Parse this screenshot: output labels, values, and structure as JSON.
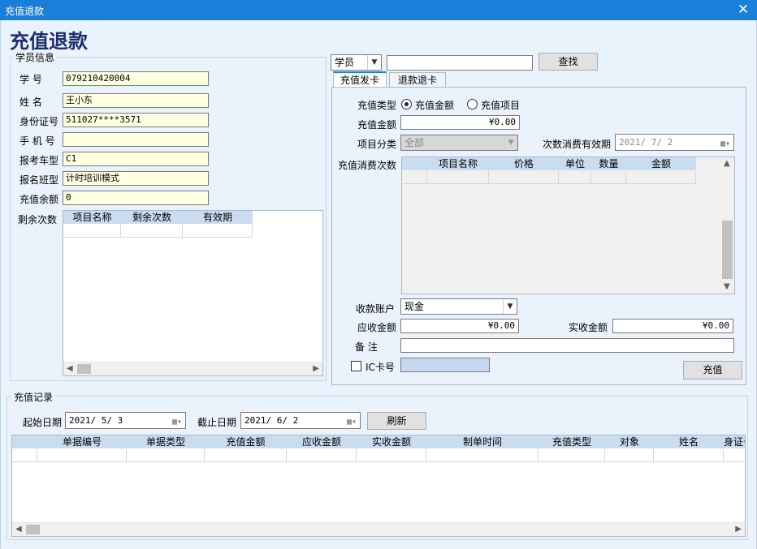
{
  "window": {
    "title": "充值退款",
    "close_glyph": "✕"
  },
  "page_title": "充值退款",
  "student_info": {
    "legend": "学员信息",
    "fields": [
      {
        "label": "学    号",
        "value": "079210420004"
      },
      {
        "label": "姓    名",
        "value": "王小东"
      },
      {
        "label": "身份证号",
        "value": "511027****3571"
      },
      {
        "label": "手 机 号",
        "value": ""
      },
      {
        "label": "报考车型",
        "value": "C1"
      },
      {
        "label": "报名班型",
        "value": "计时培训模式"
      },
      {
        "label": "充值余额",
        "value": "0"
      }
    ],
    "remaining_label": "剩余次数",
    "remaining_columns": [
      "项目名称",
      "剩余次数",
      "有效期"
    ]
  },
  "search": {
    "type_selected": "学员",
    "value": "",
    "button": "查找"
  },
  "tabs": [
    {
      "label": "充值发卡",
      "active": true
    },
    {
      "label": "退款退卡",
      "active": false
    }
  ],
  "recharge": {
    "type_label": "充值类型",
    "type_options": [
      {
        "label": "充值金额",
        "checked": true
      },
      {
        "label": "充值项目",
        "checked": false
      }
    ],
    "amount_label": "充值金额",
    "amount_value": "¥0.00",
    "category_label": "项目分类",
    "category_value": "全部",
    "validity_label": "次数消费有效期",
    "validity_value": "2021/ 7/ 2",
    "count_label": "充值消费次数",
    "count_columns": [
      "项目名称",
      "价格",
      "单位",
      "数量",
      "金额"
    ],
    "account_label": "收款账户",
    "account_value": "现金",
    "receivable_label": "应收金额",
    "receivable_value": "¥0.00",
    "received_label": "实收金额",
    "received_value": "¥0.00",
    "remark_label": "备    注",
    "remark_value": "",
    "ic_label": "IC卡号",
    "ic_checked": false,
    "ic_value": "",
    "submit": "充值"
  },
  "records": {
    "legend": "充值记录",
    "start_label": "起始日期",
    "start_value": "2021/ 5/ 3",
    "end_label": "截止日期",
    "end_value": "2021/ 6/ 2",
    "refresh": "刷新",
    "columns": [
      "单据编号",
      "单据类型",
      "充值金额",
      "应收金额",
      "实收金额",
      "制单时间",
      "充值类型",
      "对象",
      "姓名",
      "身证号"
    ]
  },
  "icons": {
    "calendar": "calendar-icon",
    "dropdown": "chevron-down-icon",
    "close": "close-icon"
  }
}
